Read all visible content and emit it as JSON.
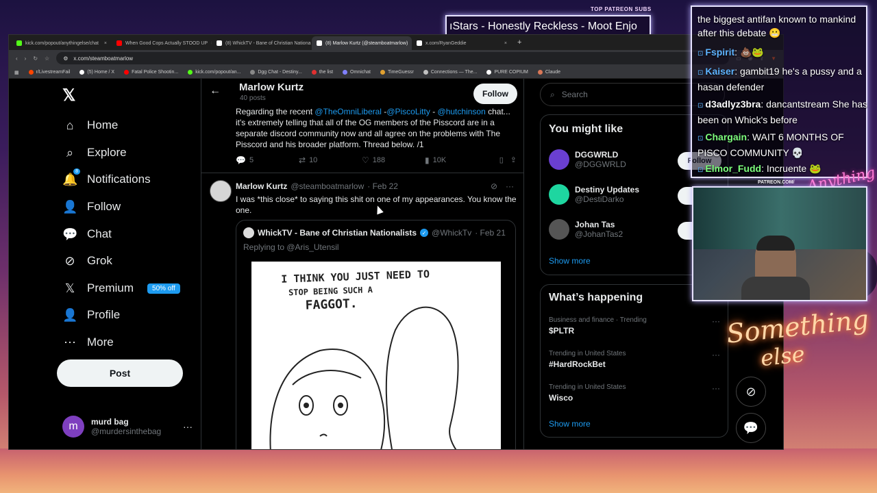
{
  "overlay": {
    "sub_label": "TOP PATREON SUBS",
    "sub_banner": "ıStars - Honestly Reckless - Moot Enjo",
    "patreon_url": "PATREON.COM/",
    "brand_script": "Anything Else",
    "neon_line1": "Something",
    "neon_line2": "else",
    "chat": [
      {
        "user": "",
        "text": "the biggest antifan known to mankind after this debate 😬",
        "color": "#ffffff"
      },
      {
        "user": "Fspirit",
        "text": ": 💩🐸",
        "color": "#5eb3ff"
      },
      {
        "user": "Kaiser",
        "text": ": gambit19 he's a pussy and a hasan defender",
        "color": "#5eb3ff"
      },
      {
        "user": "d3adlyz3bra",
        "text": ": dancantstream She has been on Whick's before",
        "color": "#ffffff"
      },
      {
        "user": "Chargain",
        "text": ": WAIT 6 MONTHS OF PISCO COMMUNITY 💀",
        "color": "#7dff7d"
      },
      {
        "user": "Elmor_Fudd",
        "text": ": Incruente 🐸",
        "color": "#7dff7d"
      }
    ]
  },
  "browser": {
    "tabs": [
      {
        "label": "kick.com/popout/anythingelse/chat",
        "color": "#53fc18"
      },
      {
        "label": "When Good Cops Actually STOOD UP",
        "color": "#ff0000"
      },
      {
        "label": "(8) WhickTV - Bane of Christian Nationa",
        "color": "#ffffff"
      },
      {
        "label": "(8) Marlow Kurtz (@steamboatmarlow)",
        "color": "#ffffff"
      },
      {
        "label": "x.com/RyanGeddie",
        "color": "#ffffff"
      }
    ],
    "new_tab": "+",
    "url": "x.com/steamboatmarlow",
    "bookmarks": [
      {
        "label": "r/LivestreamFail",
        "color": "#ff4500"
      },
      {
        "label": "(5) Home / X",
        "color": "#ffffff"
      },
      {
        "label": "Fatal Police Shootin...",
        "color": "#ff0000"
      },
      {
        "label": "kick.com/popout/an...",
        "color": "#53fc18"
      },
      {
        "label": "Dgg Chat - Destiny...",
        "color": "#888888"
      },
      {
        "label": "the list",
        "color": "#e03030"
      },
      {
        "label": "Omnichat",
        "color": "#8080ff"
      },
      {
        "label": "TimeGuessr",
        "color": "#e0a030"
      },
      {
        "label": "Connections — The...",
        "color": "#c0c0c0"
      },
      {
        "label": "PURE COPIUM",
        "color": "#ffffff"
      },
      {
        "label": "Claude",
        "color": "#d97757"
      }
    ]
  },
  "x": {
    "logo": "𝕏",
    "nav": [
      {
        "label": "Home",
        "icon": "⌂"
      },
      {
        "label": "Explore",
        "icon": "⌕"
      },
      {
        "label": "Notifications",
        "icon": "🔔"
      },
      {
        "label": "Follow",
        "icon": "👤"
      },
      {
        "label": "Chat",
        "icon": "💬"
      },
      {
        "label": "Grok",
        "icon": "⊘"
      },
      {
        "label": "Premium",
        "icon": "𝕏"
      },
      {
        "label": "Profile",
        "icon": "👤"
      },
      {
        "label": "More",
        "icon": "⋯"
      }
    ],
    "notif_count": "8",
    "premium_badge": "50% off",
    "post_button": "Post",
    "account": {
      "name": "murd bag",
      "handle": "@murdersinthebag",
      "initial": "m"
    },
    "header": {
      "name": "Marlow Kurtz",
      "posts": "40 posts",
      "follow": "Follow"
    },
    "thread_post": {
      "line1_pre": "Regarding the recent ",
      "mention1": "@TheOmniLiberal",
      "mid1": " -",
      "mention2": "@PiscoLitty",
      "mid2": " - ",
      "mention3": "@hutchinson",
      "line1_post": " chat...",
      "body": "it's extremely telling that all of the OG members of the Pisscord are in a separate discord community now and all agree on the problems with The Pisscord and his broader platform. Thread below. /1",
      "replies": "5",
      "reposts": "10",
      "likes": "188",
      "views": "10K"
    },
    "post2": {
      "name": "Marlow Kurtz",
      "handle": "@steamboatmarlow",
      "date": "· Feb 22",
      "text": "I was *this close* to saying this shit on one of my appearances. You know the one.",
      "quote": {
        "name": "WhickTV - Bane of Christian Nationalists",
        "handle": "@WhickTv",
        "date": "· Feb 21",
        "replying": "Replying to @Aris_Utensil",
        "comic_line1": "I THINK YOU JUST NEED TO",
        "comic_line2": "STOP BEING SUCH A",
        "comic_line3": "FAGGOT."
      }
    },
    "search_placeholder": "Search",
    "might_like": {
      "title": "You might like",
      "users": [
        {
          "name": "DGGWRLD",
          "handle": "@DGGWRLD",
          "color": "#6a3fd1",
          "follow": "Follow"
        },
        {
          "name": "Destiny Updates",
          "handle": "@DestiDarko",
          "color": "#1ed6a0",
          "follow": "F"
        },
        {
          "name": "Johan Tas",
          "handle": "@JohanTas2",
          "color": "#555555",
          "follow": "F"
        }
      ],
      "show_more": "Show more"
    },
    "happening": {
      "title": "What’s happening",
      "trends": [
        {
          "context": "Business and finance · Trending",
          "topic": "$PLTR"
        },
        {
          "context": "Trending in United States",
          "topic": "#HardRockBet"
        },
        {
          "context": "Trending in United States",
          "topic": "Wisco"
        }
      ],
      "show_more": "Show more"
    }
  }
}
